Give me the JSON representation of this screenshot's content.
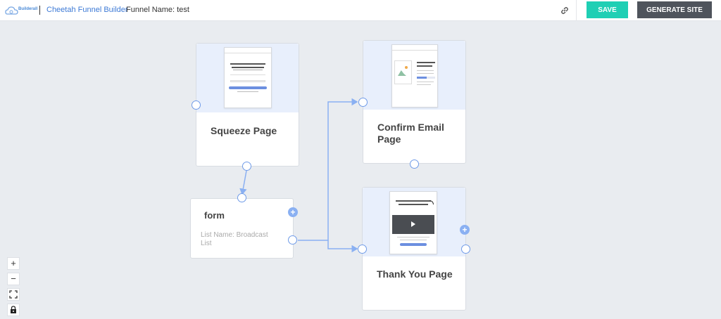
{
  "header": {
    "logo_text": "Builderall",
    "app_title": "Cheetah Funnel Builder",
    "funnel_name": "Funnel Name: test",
    "link_icon": "link-icon",
    "save_label": "SAVE",
    "generate_label": "GENERATE SITE"
  },
  "colors": {
    "accent_save": "#1fcfb4",
    "generate_bg": "#4f545c",
    "link_blue": "#3d7ad6",
    "connector": "#8ab0f2"
  },
  "nodes": {
    "squeeze": {
      "title": "Squeeze Page"
    },
    "confirm": {
      "title": "Confirm Email Page"
    },
    "thankyou": {
      "title": "Thank You Page"
    },
    "form": {
      "label": "form",
      "sub": "List Name: Broadcast List"
    }
  },
  "zoom_controls": {
    "zoom_in": "+",
    "zoom_out": "−",
    "fit_icon": "fit-screen-icon",
    "lock_icon": "lock-icon"
  }
}
